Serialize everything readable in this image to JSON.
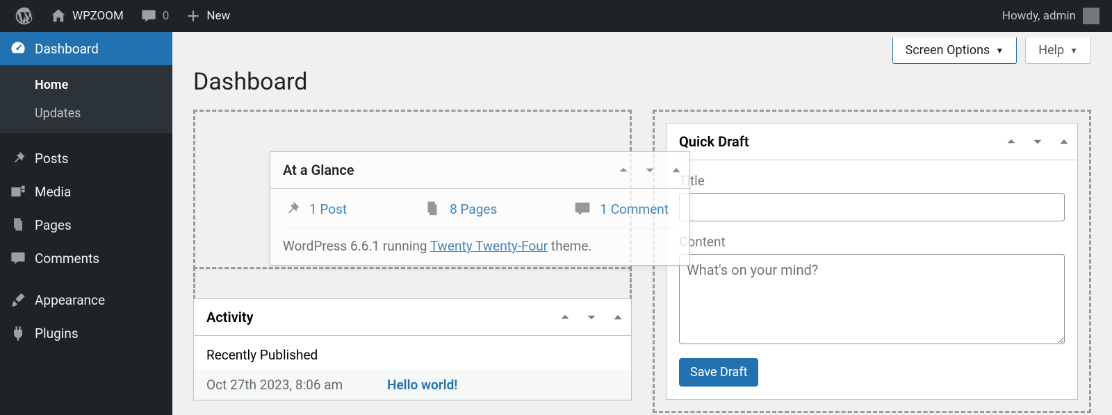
{
  "adminbar": {
    "site_name": "WPZOOM",
    "comment_count": "0",
    "new_label": "New",
    "howdy": "Howdy, admin"
  },
  "sidebar": {
    "dashboard": "Dashboard",
    "submenu": {
      "home": "Home",
      "updates": "Updates"
    },
    "posts": "Posts",
    "media": "Media",
    "pages": "Pages",
    "comments": "Comments",
    "appearance": "Appearance",
    "plugins": "Plugins"
  },
  "tabs": {
    "screen_options": "Screen Options",
    "help": "Help"
  },
  "page_title": "Dashboard",
  "glance": {
    "title": "At a Glance",
    "posts": "1 Post",
    "pages": "8 Pages",
    "comments": "1 Comment",
    "wp_running": "WordPress 6.6.1 running ",
    "theme_name": "Twenty Twenty-Four",
    "theme_suffix": " theme."
  },
  "activity": {
    "title": "Activity",
    "section": "Recently Published",
    "date": "Oct 27th 2023, 8:06 am",
    "post_title": "Hello world!"
  },
  "quickdraft": {
    "title": "Quick Draft",
    "title_label": "Title",
    "content_label": "Content",
    "content_placeholder": "What's on your mind?",
    "save": "Save Draft"
  }
}
